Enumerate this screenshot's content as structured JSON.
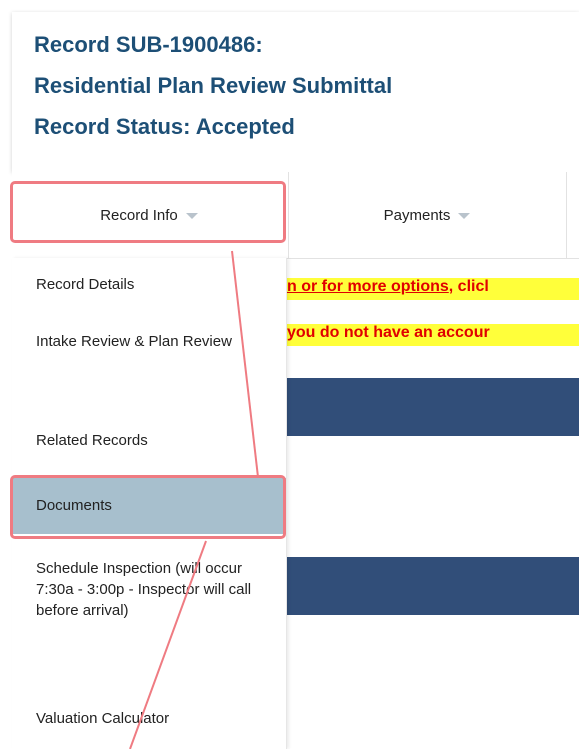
{
  "record": {
    "title_line1": "Record SUB-1900486:",
    "title_line2": "Residential Plan Review Submittal",
    "status_line": "Record Status: Accepted"
  },
  "tabs": [
    {
      "label": "Record Info",
      "icon": "caret-down-icon"
    },
    {
      "label": "Payments",
      "icon": "caret-down-icon"
    }
  ],
  "menu": {
    "items": [
      {
        "label": "Record Details"
      },
      {
        "label": "Intake Review & Plan Review"
      },
      {
        "label": "Related Records"
      },
      {
        "label": "Documents",
        "active": true
      },
      {
        "label": "Schedule Inspection (will occur 7:30a - 3:00p - Inspector will call before arrival)"
      },
      {
        "label": "Valuation Calculator"
      }
    ]
  },
  "notice": {
    "line1_link": "n or for more options",
    "line1_rest": ", clicl",
    "line2": "you do not have an accour"
  },
  "colors": {
    "title": "#1d4f76",
    "active_item": "#a7bfcd",
    "band": "#314e79",
    "highlight": "#ef7b82",
    "notice_bg": "#ffff3a",
    "notice_text": "#e00000"
  }
}
